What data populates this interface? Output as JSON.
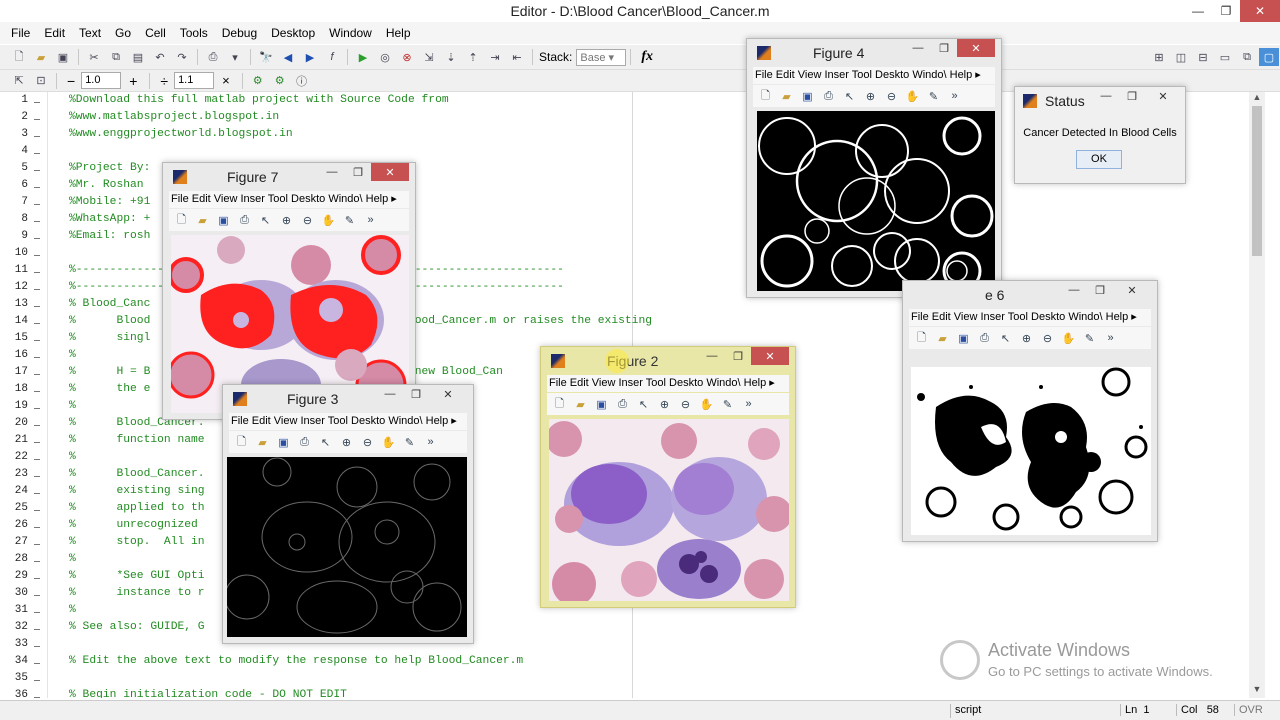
{
  "window": {
    "title": "Editor - D:\\Blood Cancer\\Blood_Cancer.m",
    "minimize": "—",
    "restore": "❐",
    "close": "✕"
  },
  "menu": [
    "File",
    "Edit",
    "Text",
    "Go",
    "Cell",
    "Tools",
    "Debug",
    "Desktop",
    "Window",
    "Help"
  ],
  "toolbar": {
    "stack_label": "Stack:",
    "stack_value": "Base",
    "fx_label": "fx",
    "cell_minus": "−",
    "cell_value1": "1.0",
    "cell_plus": "+",
    "cell_divide": "÷",
    "cell_value2": "1.1",
    "cell_x": "×"
  },
  "code_lines": [
    {
      "n": "1",
      "t": "%Download this full matlab project with Source Code from"
    },
    {
      "n": "2",
      "t": "%www.matlabsproject.blogspot.in"
    },
    {
      "n": "3",
      "t": "%www.enggprojectworld.blogspot.in"
    },
    {
      "n": "4",
      "t": ""
    },
    {
      "n": "5",
      "t": "%Project By:"
    },
    {
      "n": "6",
      "t": "%Mr. Roshan"
    },
    {
      "n": "7",
      "t": "%Mobile: +91"
    },
    {
      "n": "8",
      "t": "%WhatsApp: +"
    },
    {
      "n": "9",
      "t": "%Email: rosh"
    },
    {
      "n": "10",
      "t": ""
    },
    {
      "n": "11",
      "t": "%------------------------------------------------------------------------"
    },
    {
      "n": "12",
      "t": "%------------------------------------------------------------------------"
    },
    {
      "n": "13",
      "t": "% Blood_Canc"
    },
    {
      "n": "14",
      "t": "%      Blood                                   w Blood_Cancer.m or raises the existing"
    },
    {
      "n": "15",
      "t": "%      singl"
    },
    {
      "n": "16",
      "t": "%"
    },
    {
      "n": "17",
      "t": "%      H = B                                   o a new Blood_Can"
    },
    {
      "n": "18",
      "t": "%      the e"
    },
    {
      "n": "19",
      "t": "%"
    },
    {
      "n": "20",
      "t": "%      Blood_Cancer.                           dles,...)"
    },
    {
      "n": "21",
      "t": "%      function name                           the given"
    },
    {
      "n": "22",
      "t": "%"
    },
    {
      "n": "23",
      "t": "%      Blood_Cancer.                           a new Blo"
    },
    {
      "n": "24",
      "t": "%      existing sing                           roperty v"
    },
    {
      "n": "25",
      "t": "%      applied to th                           gFcn gets"
    },
    {
      "n": "26",
      "t": "%      unrecognized                            es proper"
    },
    {
      "n": "27",
      "t": "%      stop.  All in                           OpeningFc"
    },
    {
      "n": "28",
      "t": "%"
    },
    {
      "n": "29",
      "t": "%      *See GUI Opti                           \"GUI all"
    },
    {
      "n": "30",
      "t": "%      instance to r"
    },
    {
      "n": "31",
      "t": "%"
    },
    {
      "n": "32",
      "t": "% See also: GUIDE, G"
    },
    {
      "n": "33",
      "t": ""
    },
    {
      "n": "34",
      "t": "% Edit the above text to modify the response to help Blood_Cancer.m"
    },
    {
      "n": "35",
      "t": ""
    },
    {
      "n": "36",
      "t": "% Begin initialization code - DO NOT EDIT"
    }
  ],
  "figures": {
    "fig4": {
      "title": "Figure 4"
    },
    "fig7": {
      "title": "Figure 7"
    },
    "fig3": {
      "title": "Figure 3"
    },
    "fig2": {
      "title": "Figure 2"
    },
    "fig6": {
      "title": "e 6"
    },
    "menu_text": "File Edit View Inser Tool Deskto Windo\\ Help"
  },
  "status_dialog": {
    "title": "Status",
    "message": "Cancer Detected In Blood Cells",
    "ok_label": "OK"
  },
  "statusbar": {
    "mode": "script",
    "ln_label": "Ln",
    "ln_value": "1",
    "col_label": "Col",
    "col_value": "58",
    "ovr": "OVR"
  },
  "watermark": {
    "line1": "Activate Windows",
    "line2": "Go to PC settings to activate Windows."
  },
  "colors": {
    "comment_green": "#228b22",
    "active_figure": "#e9e7a8",
    "close_red": "#c75050"
  }
}
